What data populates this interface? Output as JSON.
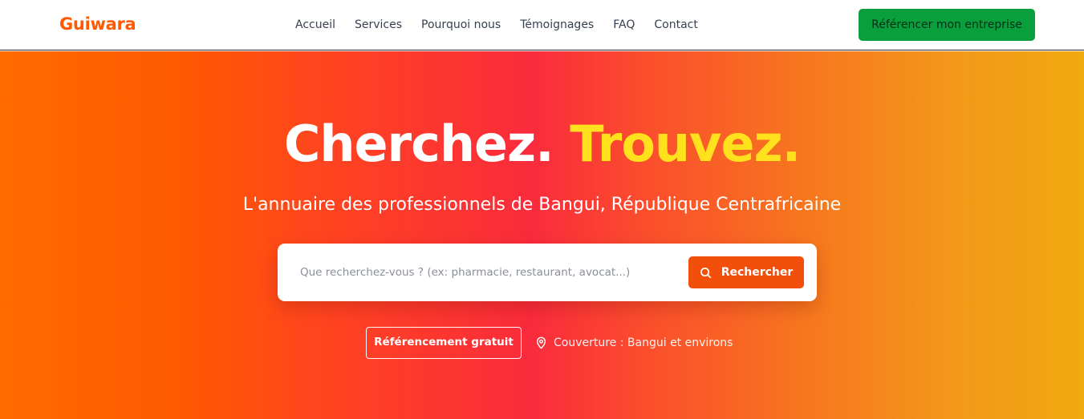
{
  "header": {
    "logo": "Guiwara",
    "nav": [
      {
        "label": "Accueil"
      },
      {
        "label": "Services"
      },
      {
        "label": "Pourquoi nous"
      },
      {
        "label": "Témoignages"
      },
      {
        "label": "FAQ"
      },
      {
        "label": "Contact"
      }
    ],
    "cta_label": "Référencer mon entreprise"
  },
  "hero": {
    "title_part1": "Cherchez.",
    "title_part2": "Trouvez.",
    "subtitle": "L'annuaire des professionnels de Bangui, République Centrafricaine",
    "search": {
      "placeholder": "Que recherchez-vous ? (ex: pharmacie, restaurant, avocat...)",
      "value": "",
      "button_label": "Rechercher",
      "button_icon": "search-icon"
    },
    "free_listing_label": "Référencement gratuit",
    "coverage": {
      "icon": "map-pin-icon",
      "text": "Couverture : Bangui et environs"
    }
  },
  "colors": {
    "brand": "#ff5a00",
    "cta_green": "#0a9f3d",
    "accent_yellow": "#ffe11d",
    "search_button": "#f24f0c"
  }
}
